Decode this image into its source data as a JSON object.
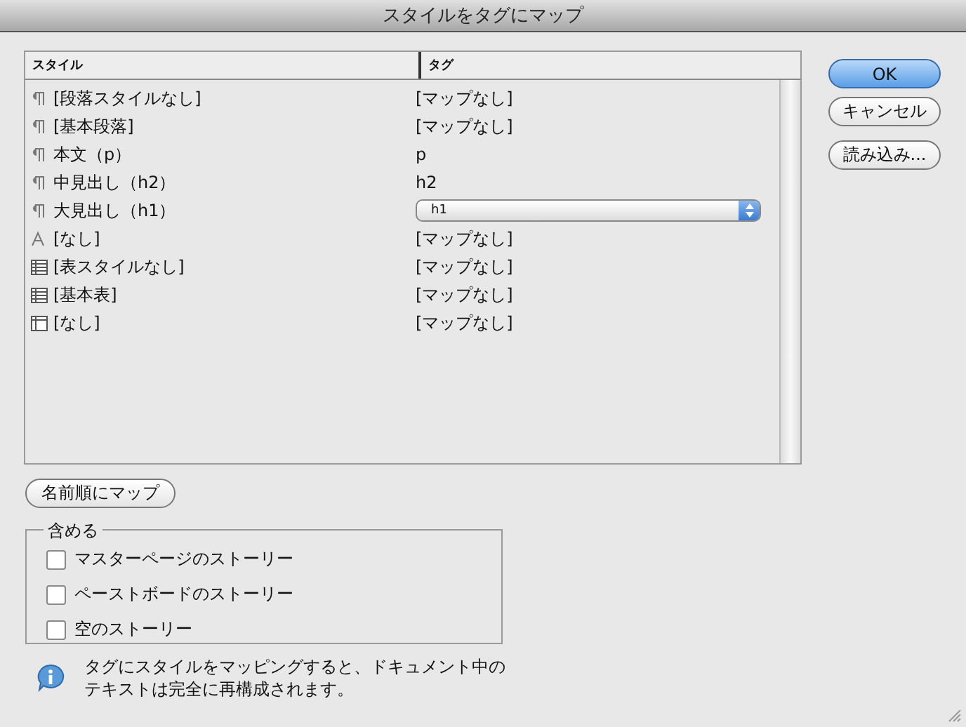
{
  "window": {
    "title": "スタイルをタグにマップ"
  },
  "table": {
    "columns": [
      "スタイル",
      "タグ"
    ],
    "rows": [
      {
        "style": {
          "kind": "paragraph",
          "text": "[段落スタイルなし]"
        },
        "tag": {
          "kind": "text",
          "text": "[マップなし]"
        }
      },
      {
        "style": {
          "kind": "paragraph",
          "text": "[基本段落]"
        },
        "tag": {
          "kind": "text",
          "text": "[マップなし]"
        }
      },
      {
        "style": {
          "kind": "paragraph",
          "text": "本文（p）"
        },
        "tag": {
          "kind": "text",
          "text": "p"
        }
      },
      {
        "style": {
          "kind": "paragraph",
          "text": "中見出し（h2）"
        },
        "tag": {
          "kind": "text",
          "text": "h2"
        }
      },
      {
        "style": {
          "kind": "paragraph",
          "text": "大見出し（h1）"
        },
        "tag": {
          "kind": "dropdown",
          "text": "h1"
        }
      },
      {
        "style": {
          "kind": "character",
          "text": "[なし]"
        },
        "tag": {
          "kind": "text",
          "text": "[マップなし]"
        }
      },
      {
        "style": {
          "kind": "table",
          "text": "[表スタイルなし]"
        },
        "tag": {
          "kind": "text",
          "text": "[マップなし]"
        }
      },
      {
        "style": {
          "kind": "table",
          "text": "[基本表]"
        },
        "tag": {
          "kind": "text",
          "text": "[マップなし]"
        }
      },
      {
        "style": {
          "kind": "cell",
          "text": "[なし]"
        },
        "tag": {
          "kind": "text",
          "text": "[マップなし]"
        }
      }
    ]
  },
  "buttons": [
    {
      "label": "OK",
      "default": true
    },
    {
      "label": "キャンセル",
      "default": false
    },
    {
      "label": "読み込み...",
      "default": false
    }
  ],
  "map_by_name_button": "名前順にマップ",
  "include": {
    "legend": "含める",
    "options": [
      {
        "label": "マスターページのストーリー",
        "checked": false
      },
      {
        "label": "ペーストボードのストーリー",
        "checked": false
      },
      {
        "label": "空のストーリー",
        "checked": false
      }
    ]
  },
  "info": "タグにスタイルをマッピングすると、ドキュメント中のテキストは完全に再構成されます。"
}
